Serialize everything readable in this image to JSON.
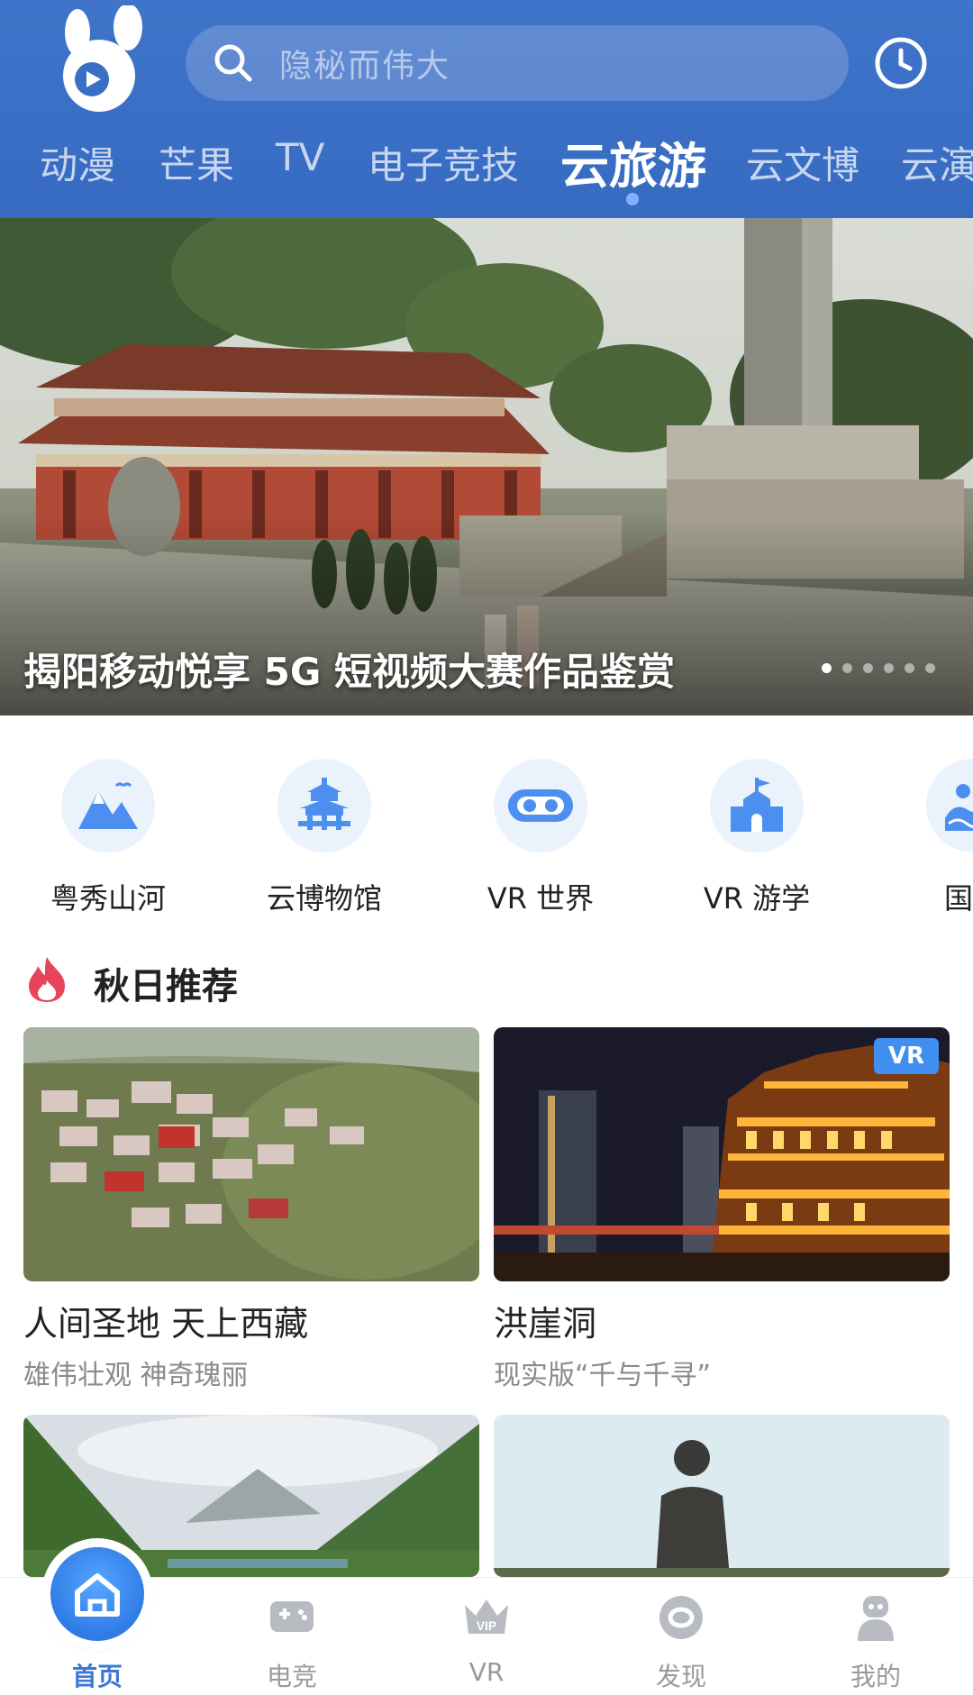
{
  "header": {
    "search_placeholder": "隐秘而伟大",
    "tabs": [
      {
        "label": "动漫"
      },
      {
        "label": "芒果"
      },
      {
        "label": "TV"
      },
      {
        "label": "电子竞技"
      },
      {
        "label": "云旅游",
        "active": true
      },
      {
        "label": "云文博"
      },
      {
        "label": "云演"
      }
    ]
  },
  "banner": {
    "title": "揭阳移动悦享 5G 短视频大赛作品鉴赏",
    "page_count": 6,
    "current_page": 1
  },
  "categories": [
    {
      "label": "粤秀山河",
      "icon": "mountain-icon"
    },
    {
      "label": "云博物馆",
      "icon": "pagoda-icon"
    },
    {
      "label": "VR 世界",
      "icon": "vr-goggles-icon"
    },
    {
      "label": "VR 游学",
      "icon": "school-icon"
    },
    {
      "label": "国内",
      "icon": "wave-person-icon"
    }
  ],
  "section": {
    "title": "秋日推荐",
    "icon": "fire-icon",
    "accent": "#e8435a"
  },
  "cards": [
    {
      "title": "人间圣地 天上西藏",
      "subtitle": "雄伟壮观 神奇瑰丽"
    },
    {
      "title": "洪崖洞",
      "subtitle": "现实版“千与千寻”",
      "badge": "VR"
    },
    {
      "title": "",
      "subtitle": ""
    },
    {
      "title": "",
      "subtitle": ""
    }
  ],
  "bottom_nav": [
    {
      "label": "首页",
      "icon": "home-icon",
      "active": true
    },
    {
      "label": "电竞",
      "icon": "gamepad-icon"
    },
    {
      "label": "VR",
      "icon": "vip-crown-icon"
    },
    {
      "label": "发现",
      "icon": "discover-icon"
    },
    {
      "label": "我的",
      "icon": "profile-icon"
    }
  ],
  "colors": {
    "header_blue": "#3a6fc6",
    "active_blue": "#3b78d8",
    "badge_blue": "#3f8ef0"
  }
}
